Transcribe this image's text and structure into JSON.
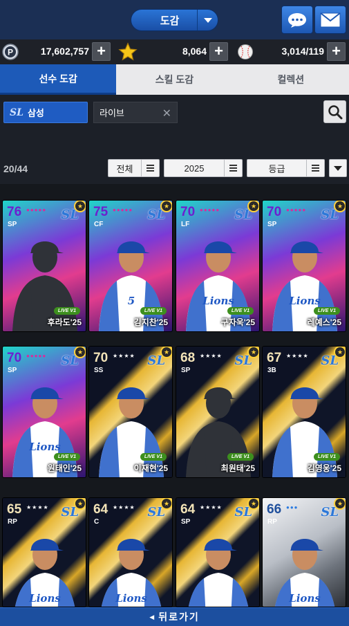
{
  "header": {
    "title": "도감",
    "chat_icon": "chat-bubble-icon",
    "mail_icon": "envelope-icon"
  },
  "currencies": [
    {
      "icon": "p-coin-icon",
      "value": "17,602,757"
    },
    {
      "icon": "star-icon",
      "value": "8,064"
    },
    {
      "icon": "baseball-icon",
      "value": "3,014/119"
    }
  ],
  "tabs": [
    {
      "label": "선수 도감",
      "active": true
    },
    {
      "label": "스킬 도감",
      "active": false
    },
    {
      "label": "컬렉션",
      "active": false
    }
  ],
  "filters": {
    "team_logo": "SL",
    "team_label": "삼성",
    "keyword": "라이브",
    "clear_icon": "close-icon",
    "search_icon": "magnifier-icon"
  },
  "list": {
    "count": "20/44",
    "select_type": "전체",
    "select_year": "2025",
    "select_grade": "등급"
  },
  "cards": [
    {
      "rating": "76",
      "position": "SP",
      "stars": "●●●●●",
      "tier": "purple",
      "name": "후라도'25",
      "live": "LIVE V1",
      "silhouette": true,
      "jersey": ""
    },
    {
      "rating": "75",
      "position": "CF",
      "stars": "●●●●●",
      "tier": "purple",
      "name": "김지찬'25",
      "live": "LIVE V1",
      "silhouette": false,
      "jersey": "5"
    },
    {
      "rating": "70",
      "position": "LF",
      "stars": "●●●●●",
      "tier": "purple",
      "name": "구자욱'25",
      "live": "LIVE V1",
      "silhouette": false,
      "jersey": "Lions"
    },
    {
      "rating": "70",
      "position": "SP",
      "stars": "●●●●●",
      "tier": "purple",
      "name": "레예스'25",
      "live": "LIVE V1",
      "silhouette": false,
      "jersey": "Lions"
    },
    {
      "rating": "70",
      "position": "SP",
      "stars": "●●●●●",
      "tier": "purple",
      "name": "원태인'25",
      "live": "LIVE V1",
      "silhouette": false,
      "jersey": "Lions"
    },
    {
      "rating": "70",
      "position": "SS",
      "stars": "★★★★",
      "tier": "gold",
      "name": "이재현'25",
      "live": "LIVE V1",
      "silhouette": false,
      "jersey": ""
    },
    {
      "rating": "68",
      "position": "SP",
      "stars": "★★★★",
      "tier": "gold",
      "name": "최원태'25",
      "live": "LIVE V1",
      "silhouette": true,
      "jersey": ""
    },
    {
      "rating": "67",
      "position": "3B",
      "stars": "★★★★",
      "tier": "gold",
      "name": "김영웅'25",
      "live": "LIVE V1",
      "silhouette": false,
      "jersey": ""
    },
    {
      "rating": "65",
      "position": "RP",
      "stars": "★★★★",
      "tier": "gold",
      "name": "",
      "live": "",
      "silhouette": false,
      "jersey": "Lions"
    },
    {
      "rating": "64",
      "position": "C",
      "stars": "★★★★",
      "tier": "gold",
      "name": "",
      "live": "",
      "silhouette": false,
      "jersey": "Lions"
    },
    {
      "rating": "64",
      "position": "SP",
      "stars": "★★★★",
      "tier": "gold",
      "name": "",
      "live": "",
      "silhouette": false,
      "jersey": ""
    },
    {
      "rating": "66",
      "position": "RP",
      "stars": "●●●",
      "tier": "silver",
      "name": "",
      "live": "",
      "silhouette": false,
      "jersey": "Lions"
    }
  ],
  "card_team_logo": "SL",
  "footer": {
    "back_label": "뒤로가기",
    "back_icon": "left-arrow-icon"
  },
  "colors": {
    "accent": "#1d5ab8",
    "purple_tier": "#6a2bbf",
    "gold_tier": "#e7b634",
    "silver_tier": "#c8ccd2"
  }
}
